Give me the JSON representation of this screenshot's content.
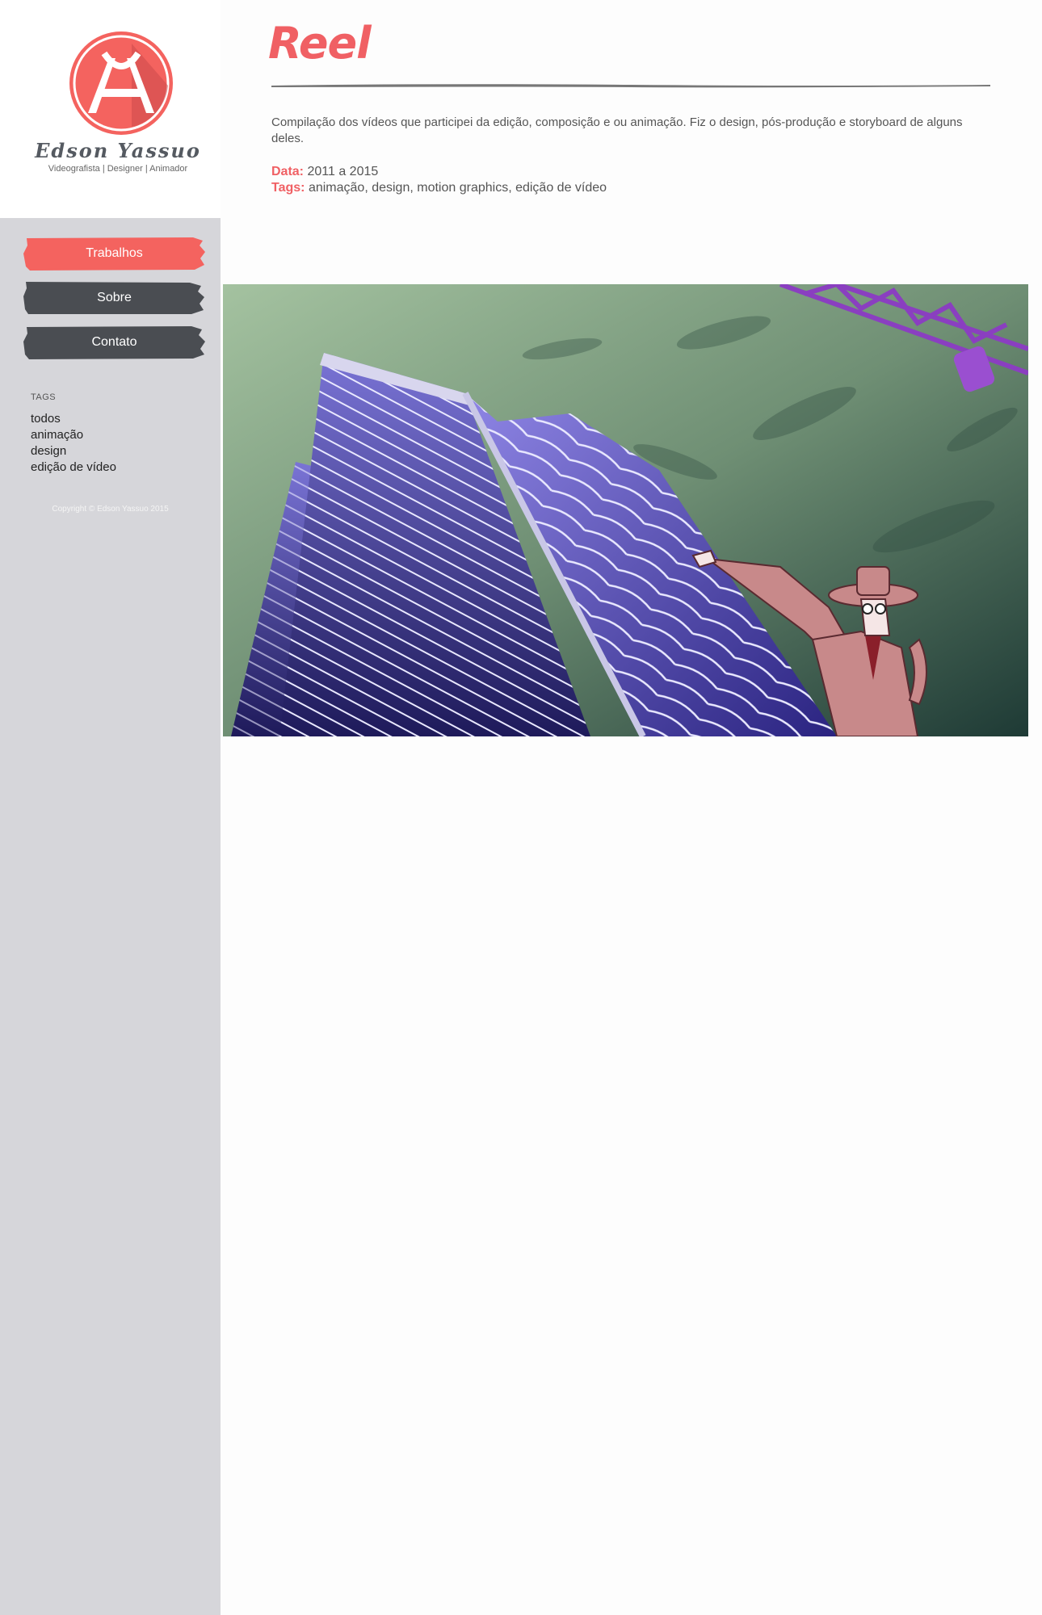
{
  "brand": {
    "name": "Edson Yassuo",
    "subtitle": "Videografista | Designer | Animador"
  },
  "nav": {
    "items": [
      {
        "label": "Trabalhos",
        "active": true,
        "color": "#f4635f"
      },
      {
        "label": "Sobre",
        "active": false,
        "color": "#4a4d52"
      },
      {
        "label": "Contato",
        "active": false,
        "color": "#4a4d52"
      }
    ]
  },
  "tags": {
    "title": "TAGS",
    "items": [
      "todos",
      "animação",
      "design",
      "edição de vídeo"
    ]
  },
  "footer": {
    "copyright": "Copyright © Edson Yassuo 2015"
  },
  "page": {
    "title": "Reel",
    "description": "Compilação dos vídeos que participei da edição, composição e ou animação. Fiz o design, pós-produção e storyboard de alguns deles.",
    "date_label": "Data:",
    "date_value": "2011 a 2015",
    "tags_label": "Tags:",
    "tags_value": "animação, design, motion graphics, edição de vídeo"
  },
  "colors": {
    "accent": "#f06064",
    "sidebar_bg": "#d6d6da",
    "button_dark": "#4a4d52"
  }
}
